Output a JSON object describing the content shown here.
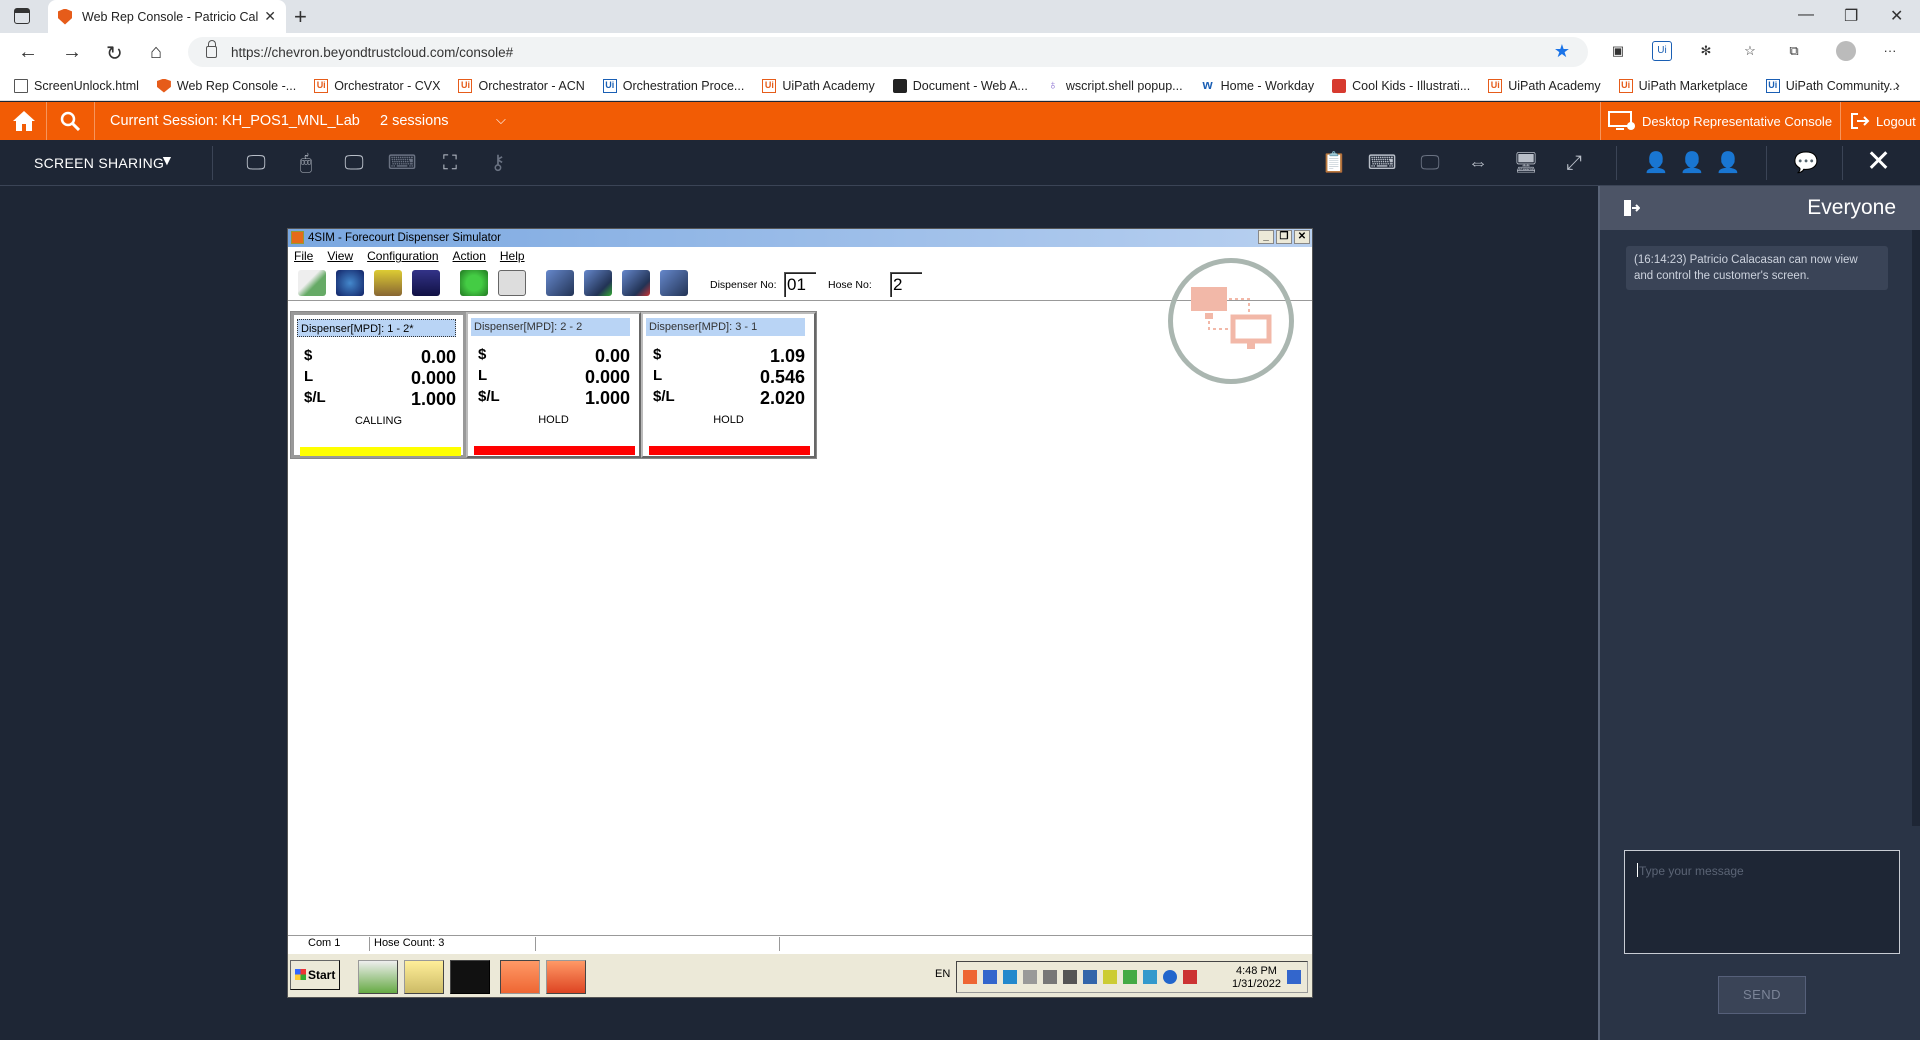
{
  "browser": {
    "tab_title": "Web Rep Console - Patricio Cala",
    "url": "https://chevron.beyondtrustcloud.com/console#",
    "bookmarks": [
      {
        "label": "ScreenUnlock.html",
        "icon": "doc-icon"
      },
      {
        "label": "Web Rep Console -...",
        "icon": "shield-icon"
      },
      {
        "label": "Orchestrator - CVX",
        "icon": "uipath-icon"
      },
      {
        "label": "Orchestrator - ACN",
        "icon": "uipath-icon"
      },
      {
        "label": "Orchestration Proce...",
        "icon": "uipath-blue-icon"
      },
      {
        "label": "UiPath Academy",
        "icon": "uipath-icon"
      },
      {
        "label": "Document - Web A...",
        "icon": "dark-icon"
      },
      {
        "label": "wscript.shell popup...",
        "icon": "pin-icon"
      },
      {
        "label": "Home - Workday",
        "icon": "workday-icon"
      },
      {
        "label": "Cool Kids - Illustrati...",
        "icon": "coolkids-icon"
      },
      {
        "label": "UiPath Academy",
        "icon": "uipath-icon"
      },
      {
        "label": "UiPath Marketplace",
        "icon": "uipath-icon"
      },
      {
        "label": "UiPath Community...",
        "icon": "uipath-blue-icon"
      }
    ]
  },
  "session_bar": {
    "current_session": "Current Session: KH_POS1_MNL_Lab",
    "sessions": "2 sessions",
    "desktop_console": "Desktop Representative Console",
    "logout": "Logout",
    "accent": "#f25c05"
  },
  "toolbar": {
    "mode_label": "SCREEN SHARING"
  },
  "remote_app": {
    "title": "4SIM - Forecourt Dispenser Simulator",
    "menu": [
      "File",
      "View",
      "Configuration",
      "Action",
      "Help"
    ],
    "dispenser_no_label": "Dispenser No:",
    "dispenser_no": "01",
    "hose_no_label": "Hose No:",
    "hose_no": "2",
    "dispensers": [
      {
        "header": "Dispenser[MPD]: 1 - 2*",
        "amount": "0.00",
        "liters": "0.000",
        "price": "1.000",
        "status": "CALLING",
        "status_color": "#ffff00"
      },
      {
        "header": "Dispenser[MPD]: 2 - 2",
        "amount": "0.00",
        "liters": "0.000",
        "price": "1.000",
        "status": "HOLD",
        "status_color": "#ff0000"
      },
      {
        "header": "Dispenser[MPD]: 3 - 1",
        "amount": "1.09",
        "liters": "0.546",
        "price": "2.020",
        "status": "HOLD",
        "status_color": "#ff0000"
      }
    ],
    "row_labels": {
      "amount": "$",
      "liters": "L",
      "price": "$/L"
    },
    "status_com": "Com 1",
    "status_hose_count": "Hose Count: 3",
    "taskbar": {
      "start": "Start",
      "lang": "EN",
      "time": "4:48 PM",
      "date": "1/31/2022"
    }
  },
  "chat": {
    "title": "Everyone",
    "messages": [
      "(16:14:23) Patricio Calacasan can now view and control the customer's screen."
    ],
    "placeholder": "Type your message",
    "send": "SEND"
  }
}
